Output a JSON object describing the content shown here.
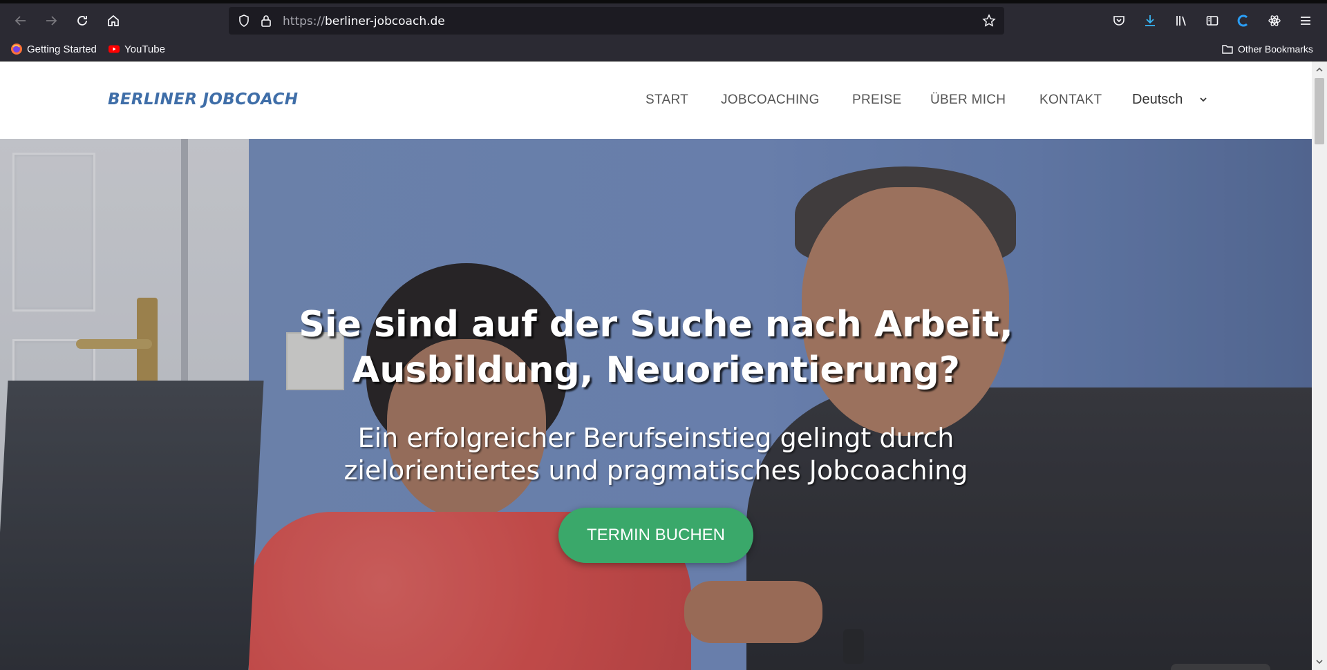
{
  "browser": {
    "url_scheme": "https://",
    "url_host": "berliner-jobcoach.de",
    "bookmarks": [
      {
        "label": "Getting Started",
        "icon": "firefox-icon"
      },
      {
        "label": "YouTube",
        "icon": "youtube-icon"
      }
    ],
    "other_bookmarks": "Other Bookmarks"
  },
  "site": {
    "brand": "BERLINER JOBCOACH",
    "menu": [
      "START",
      "JOBCOACHING",
      "PREISE",
      "ÜBER MICH",
      "KONTAKT"
    ],
    "language": "Deutsch"
  },
  "hero": {
    "title_line1": "Sie sind auf der Suche nach Arbeit,",
    "title_line2": "Ausbildung, Neuorientierung?",
    "sub_line1": "Ein erfolgreicher Berufseinstieg gelingt durch",
    "sub_line2": "zielorientiertes und pragmatisches Jobcoaching",
    "cta": "TERMIN BUCHEN"
  },
  "colors": {
    "brand": "#3f6ea8",
    "cta": "#3aa86a",
    "chrome": "#2b2a33"
  }
}
